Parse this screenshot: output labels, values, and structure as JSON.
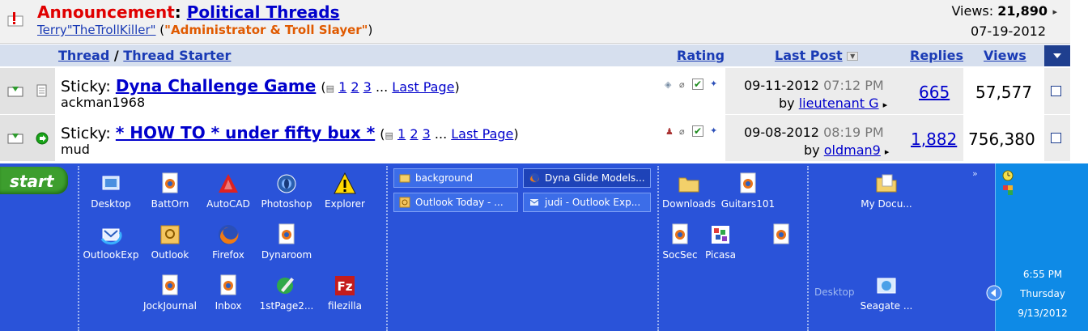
{
  "announcement": {
    "label": "Announcement",
    "colon": ":",
    "title": "Political Threads",
    "author": "Terry\"TheTrollKiller\"",
    "role_open": " (",
    "role": "\"Administrator & Troll Slayer\"",
    "role_close": ")",
    "views_label": "Views:",
    "views_value": "21,890",
    "date": "07-19-2012"
  },
  "table_header": {
    "thread": "Thread",
    "slash": "/",
    "thread_starter": "Thread Starter",
    "rating": "Rating",
    "last_post": "Last Post",
    "replies": "Replies",
    "views": "Views"
  },
  "threads": [
    {
      "prefix": "Sticky:",
      "title": "Dyna Challenge Game",
      "pages": [
        "1",
        "2",
        "3"
      ],
      "ellipsis": "...",
      "last_page": "Last Page",
      "starter": "ackman1968",
      "last_post_date": "09-11-2012",
      "last_post_time": "07:12 PM",
      "by": "by",
      "last_poster": "lieutenant G",
      "replies": "665",
      "views": "57,577"
    },
    {
      "prefix": "Sticky:",
      "title": "* HOW TO * under fifty bux *",
      "pages": [
        "1",
        "2",
        "3"
      ],
      "ellipsis": "...",
      "last_page": "Last Page",
      "starter": "mud",
      "last_post_date": "09-08-2012",
      "last_post_time": "08:19 PM",
      "by": "by",
      "last_poster": "oldman9",
      "replies": "1,882",
      "views": "756,380"
    }
  ],
  "taskbar": {
    "start_label": "start",
    "desktop_icons_1": [
      {
        "label": "Desktop",
        "icon": "desktop-icon"
      },
      {
        "label": "BattOrn",
        "icon": "firefox-doc-icon"
      },
      {
        "label": "AutoCAD",
        "icon": "autocad-icon"
      },
      {
        "label": "Photoshop",
        "icon": "photoshop-icon"
      },
      {
        "label": "Explorer",
        "icon": "warning-icon"
      },
      {
        "label": "OutlookExp",
        "icon": "outlook-express-icon"
      },
      {
        "label": "Outlook",
        "icon": "outlook-icon"
      },
      {
        "label": "Firefox",
        "icon": "firefox-icon"
      },
      {
        "label": "Dynaroom",
        "icon": "firefox-doc-icon"
      },
      {
        "label": "JockJournal",
        "icon": "firefox-doc-icon"
      },
      {
        "label": "Inbox",
        "icon": "firefox-doc-icon"
      },
      {
        "label": "1stPage2...",
        "icon": "html-editor-icon"
      },
      {
        "label": "filezilla",
        "icon": "filezilla-icon"
      }
    ],
    "task_buttons": [
      {
        "label": "background",
        "icon": "folder-icon"
      },
      {
        "label": "Dyna Glide Models...",
        "icon": "firefox-icon"
      },
      {
        "label": "Outlook Today - ...",
        "icon": "outlook-icon"
      },
      {
        "label": "judi - Outlook Exp...",
        "icon": "outlook-express-icon"
      }
    ],
    "desktop_icons_2": [
      {
        "label": "Downloads",
        "icon": "folder-icon"
      },
      {
        "label": "Guitars101",
        "icon": "firefox-doc-icon"
      },
      {
        "label": "SocSec",
        "icon": "firefox-doc-icon"
      },
      {
        "label": "Picasa",
        "icon": "picasa-icon"
      },
      {
        "label": "",
        "icon": "firefox-doc-icon"
      }
    ],
    "chevron": "»",
    "my_docs": "My Docu...",
    "desktop_label": "Desktop",
    "seagate": "Seagate ...",
    "clock_time": "6:55 PM",
    "clock_day": "Thursday",
    "clock_date": "9/13/2012"
  }
}
